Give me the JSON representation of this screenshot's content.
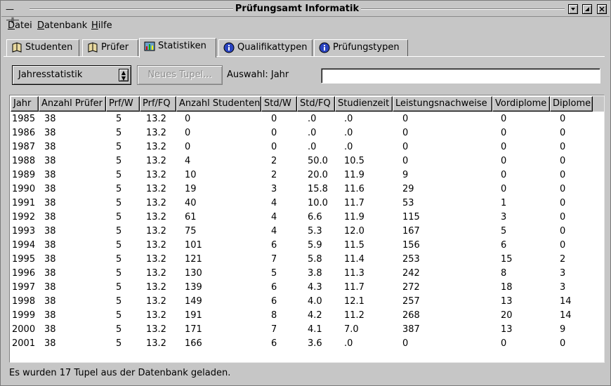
{
  "window": {
    "title": "Prüfungsamt Informatik",
    "menu_glyph": "— ⊣⊢",
    "buttons": [
      "minimize",
      "maximize",
      "close"
    ]
  },
  "menubar": {
    "items": [
      {
        "underline": "D",
        "rest": "atei"
      },
      {
        "underline": "D",
        "rest": "atenbank"
      },
      {
        "underline": "H",
        "rest": "ilfe"
      }
    ]
  },
  "tabs": [
    {
      "label": "Studenten",
      "icon": "book-icon",
      "active": false
    },
    {
      "label": "Prüfer",
      "icon": "book-icon",
      "active": false
    },
    {
      "label": "Statistiken",
      "icon": "statistics-icon",
      "active": true
    },
    {
      "label": "Qualifikattypen",
      "icon": "info-icon",
      "active": false
    },
    {
      "label": "Prüfungstypen",
      "icon": "info-icon",
      "active": false
    }
  ],
  "controls": {
    "select_value": "Jahresstatistik",
    "new_tuple_button": "Neues Tupel...",
    "selection_label": "Auswahl: Jahr",
    "selection_value": ""
  },
  "table": {
    "columns": [
      "Jahr",
      "Anzahl Prüfer",
      "Prf/W",
      "Prf/FQ",
      "Anzahl Studenten",
      "Std/W",
      "Std/FQ",
      "Studienzeit",
      "Leistungsnachweise",
      "Vordiplome",
      "Diplome"
    ],
    "rows": [
      [
        "1985",
        "38",
        "5",
        "13.2",
        "0",
        "0",
        ".0",
        ".0",
        "0",
        "0",
        "0"
      ],
      [
        "1986",
        "38",
        "5",
        "13.2",
        "0",
        "0",
        ".0",
        ".0",
        "0",
        "0",
        "0"
      ],
      [
        "1987",
        "38",
        "5",
        "13.2",
        "0",
        "0",
        ".0",
        ".0",
        "0",
        "0",
        "0"
      ],
      [
        "1988",
        "38",
        "5",
        "13.2",
        "4",
        "2",
        "50.0",
        "10.5",
        "0",
        "0",
        "0"
      ],
      [
        "1989",
        "38",
        "5",
        "13.2",
        "10",
        "2",
        "20.0",
        "11.9",
        "9",
        "0",
        "0"
      ],
      [
        "1990",
        "38",
        "5",
        "13.2",
        "19",
        "3",
        "15.8",
        "11.6",
        "29",
        "0",
        "0"
      ],
      [
        "1991",
        "38",
        "5",
        "13.2",
        "40",
        "4",
        "10.0",
        "11.7",
        "53",
        "1",
        "0"
      ],
      [
        "1992",
        "38",
        "5",
        "13.2",
        "61",
        "4",
        "6.6",
        "11.9",
        "115",
        "3",
        "0"
      ],
      [
        "1993",
        "38",
        "5",
        "13.2",
        "75",
        "4",
        "5.3",
        "12.0",
        "167",
        "5",
        "0"
      ],
      [
        "1994",
        "38",
        "5",
        "13.2",
        "101",
        "6",
        "5.9",
        "11.5",
        "156",
        "6",
        "0"
      ],
      [
        "1995",
        "38",
        "5",
        "13.2",
        "121",
        "7",
        "5.8",
        "11.4",
        "253",
        "15",
        "2"
      ],
      [
        "1996",
        "38",
        "5",
        "13.2",
        "130",
        "5",
        "3.8",
        "11.3",
        "242",
        "8",
        "3"
      ],
      [
        "1997",
        "38",
        "5",
        "13.2",
        "139",
        "6",
        "4.3",
        "11.7",
        "272",
        "18",
        "3"
      ],
      [
        "1998",
        "38",
        "5",
        "13.2",
        "149",
        "6",
        "4.0",
        "12.1",
        "257",
        "13",
        "14"
      ],
      [
        "1999",
        "38",
        "5",
        "13.2",
        "191",
        "8",
        "4.2",
        "11.2",
        "268",
        "20",
        "14"
      ],
      [
        "2000",
        "38",
        "5",
        "13.2",
        "171",
        "7",
        "4.1",
        "7.0",
        "387",
        "13",
        "9"
      ],
      [
        "2001",
        "38",
        "5",
        "13.2",
        "166",
        "6",
        "3.6",
        ".0",
        "0",
        "0",
        "0"
      ]
    ]
  },
  "status": {
    "text": "Es wurden 17 Tupel aus der Datenbank geladen."
  }
}
